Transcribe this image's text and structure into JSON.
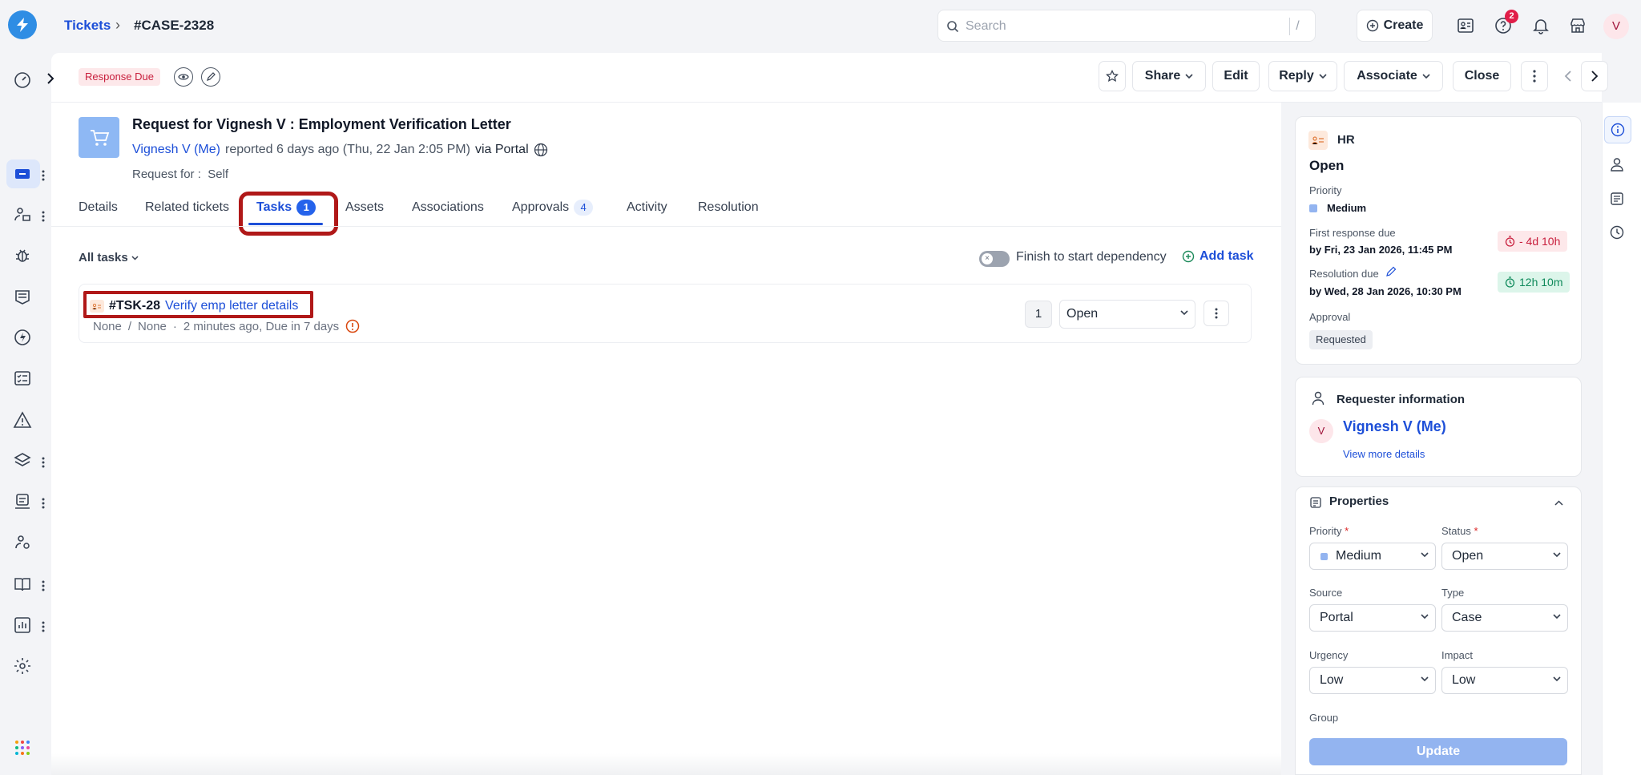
{
  "breadcrumb": {
    "root": "Tickets",
    "separator": "›",
    "current": "#CASE-2328"
  },
  "topbar": {
    "search_placeholder": "Search",
    "search_shortcut": "/",
    "create_label": "Create",
    "help_badge": "2",
    "avatar_initial": "V"
  },
  "actionbar": {
    "status_badge": "Response Due",
    "buttons": {
      "share": "Share",
      "edit": "Edit",
      "reply": "Reply",
      "associate": "Associate",
      "close": "Close"
    }
  },
  "ticket": {
    "title": "Request for Vignesh V : Employment Verification Letter",
    "reporter": "Vignesh V (Me)",
    "reported_text": "reported 6 days ago (Thu, 22 Jan 2:05 PM)",
    "via_text": "via Portal",
    "request_for_label": "Request for :",
    "request_for_value": "Self"
  },
  "tabs": [
    {
      "label": "Details"
    },
    {
      "label": "Related tickets"
    },
    {
      "label": "Tasks",
      "count": "1"
    },
    {
      "label": "Assets"
    },
    {
      "label": "Associations"
    },
    {
      "label": "Approvals",
      "count": "4"
    },
    {
      "label": "Activity"
    },
    {
      "label": "Resolution"
    }
  ],
  "tasks": {
    "filter_label": "All tasks",
    "dependency_label": "Finish to start dependency",
    "add_task_label": "Add task",
    "items": [
      {
        "id": "#TSK-28",
        "name": "Verify emp letter details",
        "assignee": "None",
        "meta_sep": "/",
        "group": "None",
        "meta_dot": "·",
        "time_text": "2 minutes ago, Due in 7 days",
        "count": "1",
        "status": "Open"
      }
    ]
  },
  "summary_card": {
    "department": "HR",
    "status": "Open",
    "priority_label": "Priority",
    "priority_value": "Medium",
    "first_response_label": "First response due",
    "first_response_value": "by Fri, 23 Jan 2026, 11:45 PM",
    "first_response_sla": "- 4d 10h",
    "resolution_label": "Resolution due",
    "resolution_value": "by Wed, 28 Jan 2026, 10:30 PM",
    "resolution_sla": "12h 10m",
    "approval_label": "Approval",
    "approval_value": "Requested"
  },
  "requester": {
    "heading": "Requester information",
    "avatar_initial": "V",
    "name": "Vignesh V (Me)",
    "more_link": "View more details"
  },
  "properties": {
    "heading": "Properties",
    "required_mark": "*",
    "priority_label": "Priority",
    "priority_value": "Medium",
    "status_label": "Status",
    "status_value": "Open",
    "source_label": "Source",
    "source_value": "Portal",
    "type_label": "Type",
    "type_value": "Case",
    "urgency_label": "Urgency",
    "urgency_value": "Low",
    "impact_label": "Impact",
    "impact_value": "Low",
    "group_label": "Group",
    "update_label": "Update"
  },
  "colors": {
    "accent": "#1d4fd8",
    "highlight_box": "#b01818",
    "danger": "#c81e3c",
    "success": "#0f8a5b"
  }
}
